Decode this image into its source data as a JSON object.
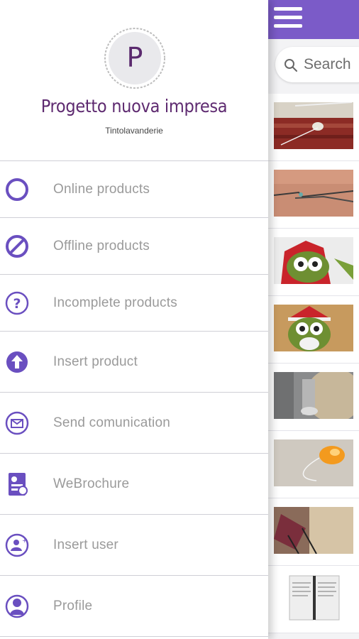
{
  "drawer": {
    "avatar_letter": "P",
    "company_name": "Progetto nuova impresa",
    "company_subtitle": "Tintolavanderie",
    "items": [
      {
        "label": "Online products",
        "icon": "circle-outline-icon"
      },
      {
        "label": "Offline products",
        "icon": "block-icon"
      },
      {
        "label": "Incomplete products",
        "icon": "question-icon"
      },
      {
        "label": "Insert product",
        "icon": "upload-arrow-icon"
      },
      {
        "label": "Send comunication",
        "icon": "mail-icon"
      },
      {
        "label": "WeBrochure",
        "icon": "brochure-icon"
      },
      {
        "label": "Insert user",
        "icon": "add-user-icon"
      },
      {
        "label": "Profile",
        "icon": "profile-icon"
      }
    ]
  },
  "app": {
    "menu_icon": "hamburger-icon",
    "search": {
      "placeholder": "Search",
      "icon": "search-icon"
    },
    "products": [
      {
        "thumb": "carpet-photo"
      },
      {
        "thumb": "glasses-photo"
      },
      {
        "thumb": "owl-decoration-photo"
      },
      {
        "thumb": "owl-decoration-photo"
      },
      {
        "thumb": "lamp-photo"
      },
      {
        "thumb": "orange-object-photo"
      },
      {
        "thumb": "chair-photo"
      },
      {
        "thumb": "document-photo"
      }
    ]
  },
  "colors": {
    "accent": "#6a4fc0",
    "app_bar": "#7b5bc8",
    "brand_text": "#5e2a70",
    "menu_text": "#9a9a9a"
  }
}
